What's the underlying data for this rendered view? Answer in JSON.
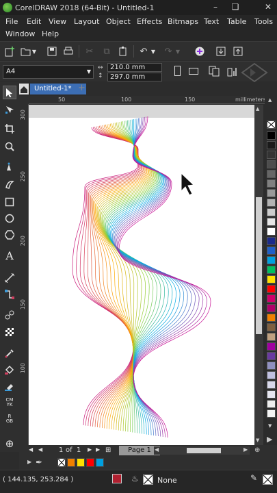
{
  "window": {
    "title": "CorelDRAW 2018 (64-Bit) - Untitled-1"
  },
  "menu": [
    {
      "label": "File"
    },
    {
      "label": "Edit"
    },
    {
      "label": "View"
    },
    {
      "label": "Layout"
    },
    {
      "label": "Object"
    },
    {
      "label": "Effects"
    },
    {
      "label": "Bitmaps"
    },
    {
      "label": "Text"
    },
    {
      "label": "Table"
    },
    {
      "label": "Tools"
    },
    {
      "label": "Window"
    },
    {
      "label": "Help"
    }
  ],
  "property_bar": {
    "page_size": "A4",
    "width": "210.0 mm",
    "height": "297.0 mm"
  },
  "tabs": {
    "document": "Untitled-1*",
    "add": "+"
  },
  "ruler": {
    "units": "millimeters",
    "h_ticks": [
      "50",
      "100",
      "150"
    ],
    "v_ticks": [
      "300",
      "250",
      "200",
      "150",
      "100"
    ]
  },
  "page_nav": {
    "current": "1",
    "of_label": "of",
    "total": "1",
    "page_tab": "Page 1"
  },
  "status": {
    "coordinates": "( 144.135, 253.284 )",
    "fill": "None"
  },
  "toolbox_icons": [
    "pick-tool-icon",
    "shape-tool-icon",
    "crop-tool-icon",
    "zoom-tool-icon",
    "freehand-tool-icon",
    "artistic-media-icon",
    "rectangle-tool-icon",
    "ellipse-tool-icon",
    "polygon-tool-icon",
    "text-tool-icon",
    "parallel-dimension-icon",
    "connector-tool-icon",
    "blend-tool-icon",
    "transparency-tool-icon",
    "eyedropper-tool-icon",
    "interactive-fill-icon",
    "smart-fill-icon",
    "cmyk-tool-icon",
    "rgb-tool-icon",
    "add-tool-icon"
  ],
  "colors": {
    "accent": "#3c6eb4",
    "palette": [
      "#000000",
      "#1a1a1a",
      "#333333",
      "#4d4d4d",
      "#666666",
      "#808080",
      "#999999",
      "#b3b3b3",
      "#cccccc",
      "#e6e6e6",
      "#ffffff",
      "#1b2a8a",
      "#2060c8",
      "#00a0e0",
      "#00c060",
      "#ffe000",
      "#ff0000",
      "#d0006a",
      "#b0006a",
      "#f08000",
      "#806040",
      "#c0a080",
      "#a000a0",
      "#6a3aa0",
      "#9090c0",
      "#c0c0e0",
      "#d8d8ea",
      "#e6e6f0",
      "#eeeeee",
      "#f4f4f4"
    ],
    "document_palette": [
      "#f08000",
      "#ffe000",
      "#ff0000",
      "#00a0e0"
    ]
  }
}
